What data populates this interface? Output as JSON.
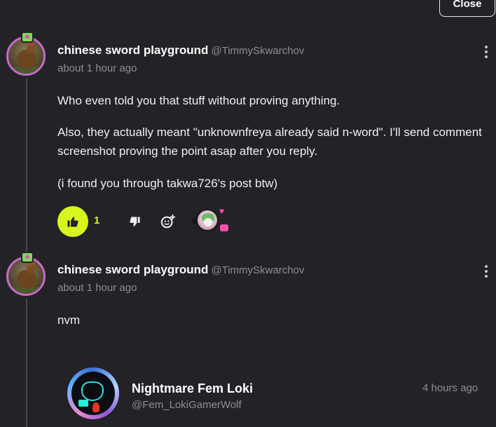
{
  "header": {
    "close_label": "Close"
  },
  "comments": [
    {
      "username": "chinese sword playground",
      "handle": "@TimmySkwarchov",
      "timestamp": "about 1 hour ago",
      "paragraphs": [
        "Who even told you that stuff without proving anything.",
        "Also, they actually meant \"unknownfreya already said n-word\". I'll send comment screenshot proving the point asap after you reply.",
        "(i found you through takwa726's post btw)"
      ],
      "reactions": {
        "like_count": "1",
        "like_icon": "thumbs-up-icon",
        "dislike_icon": "thumbs-down-icon",
        "add_reaction_icon": "add-emoji-icon"
      }
    },
    {
      "username": "chinese sword playground",
      "handle": "@TimmySkwarchov",
      "timestamp": "about 1 hour ago",
      "paragraphs": [
        "nvm"
      ]
    }
  ],
  "reply_preview": {
    "name": "Nightmare Fem Loki",
    "handle": "@Fem_LokiGamerWolf",
    "timestamp": "4 hours ago"
  },
  "colors": {
    "background": "#232227",
    "like_accent": "#d8f51d",
    "avatar_ring": "#c66acb",
    "muted_text": "#8e8d94",
    "reaction_pink": "#ff4fae"
  }
}
